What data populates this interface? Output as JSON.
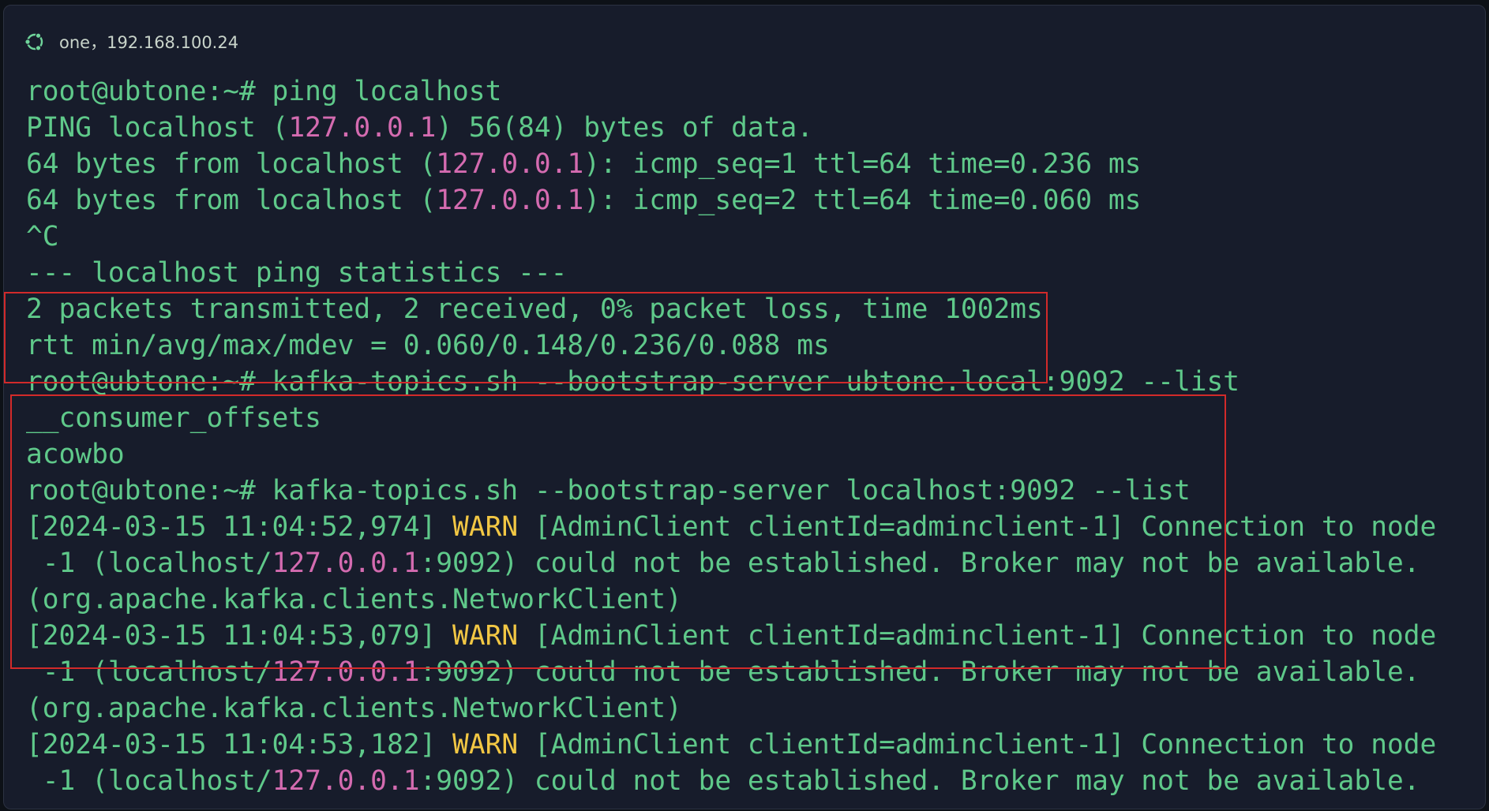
{
  "window": {
    "title": "one，192.168.100.24",
    "icon": "ubuntu-icon"
  },
  "terminal": {
    "lines": [
      [
        {
          "t": "root@ubtone:~# ping localhost",
          "c": "text"
        }
      ],
      [
        {
          "t": "PING localhost (",
          "c": "text"
        },
        {
          "t": "127.0.0.1",
          "c": "ip"
        },
        {
          "t": ") 56(84) bytes of data.",
          "c": "text"
        }
      ],
      [
        {
          "t": "64 bytes from localhost (",
          "c": "text"
        },
        {
          "t": "127.0.0.1",
          "c": "ip"
        },
        {
          "t": "): icmp_seq=1 ttl=64 time=0.236 ms",
          "c": "text"
        }
      ],
      [
        {
          "t": "64 bytes from localhost (",
          "c": "text"
        },
        {
          "t": "127.0.0.1",
          "c": "ip"
        },
        {
          "t": "): icmp_seq=2 ttl=64 time=0.060 ms",
          "c": "text"
        }
      ],
      [
        {
          "t": "^C",
          "c": "text"
        }
      ],
      [
        {
          "t": "--- localhost ping statistics ---",
          "c": "text"
        }
      ],
      [
        {
          "t": "2 packets transmitted, 2 received, 0% packet loss, time 1002ms",
          "c": "text"
        }
      ],
      [
        {
          "t": "rtt min/avg/max/mdev = 0.060/0.148/0.236/0.088 ms",
          "c": "text"
        }
      ],
      [
        {
          "t": "root@ubtone:~# kafka-topics.sh --bootstrap-server ubtone.local:9092 --list",
          "c": "text"
        }
      ],
      [
        {
          "t": "__consumer_offsets",
          "c": "text"
        }
      ],
      [
        {
          "t": "acowbo",
          "c": "text"
        }
      ],
      [
        {
          "t": "root@ubtone:~# kafka-topics.sh --bootstrap-server localhost:9092 --list",
          "c": "text"
        }
      ],
      [
        {
          "t": "[2024-03-15 11:04:52,974] ",
          "c": "text"
        },
        {
          "t": "WARN",
          "c": "warn"
        },
        {
          "t": " [AdminClient clientId=adminclient-1] Connection to node",
          "c": "text"
        }
      ],
      [
        {
          "t": " -1 (localhost/",
          "c": "text"
        },
        {
          "t": "127.0.0.1",
          "c": "ip"
        },
        {
          "t": ":9092) could not be established. Broker may not be available.",
          "c": "text"
        }
      ],
      [
        {
          "t": "(org.apache.kafka.clients.NetworkClient)",
          "c": "text"
        }
      ],
      [
        {
          "t": "[2024-03-15 11:04:53,079] ",
          "c": "text"
        },
        {
          "t": "WARN",
          "c": "warn"
        },
        {
          "t": " [AdminClient clientId=adminclient-1] Connection to node",
          "c": "text"
        }
      ],
      [
        {
          "t": " -1 (localhost/",
          "c": "text"
        },
        {
          "t": "127.0.0.1",
          "c": "ip"
        },
        {
          "t": ":9092) could not be established. Broker may not be available.",
          "c": "text"
        }
      ],
      [
        {
          "t": "(org.apache.kafka.clients.NetworkClient)",
          "c": "text"
        }
      ],
      [
        {
          "t": "[2024-03-15 11:04:53,182] ",
          "c": "text"
        },
        {
          "t": "WARN",
          "c": "warn"
        },
        {
          "t": " [AdminClient clientId=adminclient-1] Connection to node",
          "c": "text"
        }
      ],
      [
        {
          "t": " -1 (localhost/",
          "c": "text"
        },
        {
          "t": "127.0.0.1",
          "c": "ip"
        },
        {
          "t": ":9092) could not be established. Broker may not be available.",
          "c": "text"
        }
      ]
    ]
  },
  "colors": {
    "background": "#171c2b",
    "text": "#5fc98a",
    "ip": "#d46bb0",
    "warn": "#f2c744",
    "highlight": "#d22a2a"
  }
}
